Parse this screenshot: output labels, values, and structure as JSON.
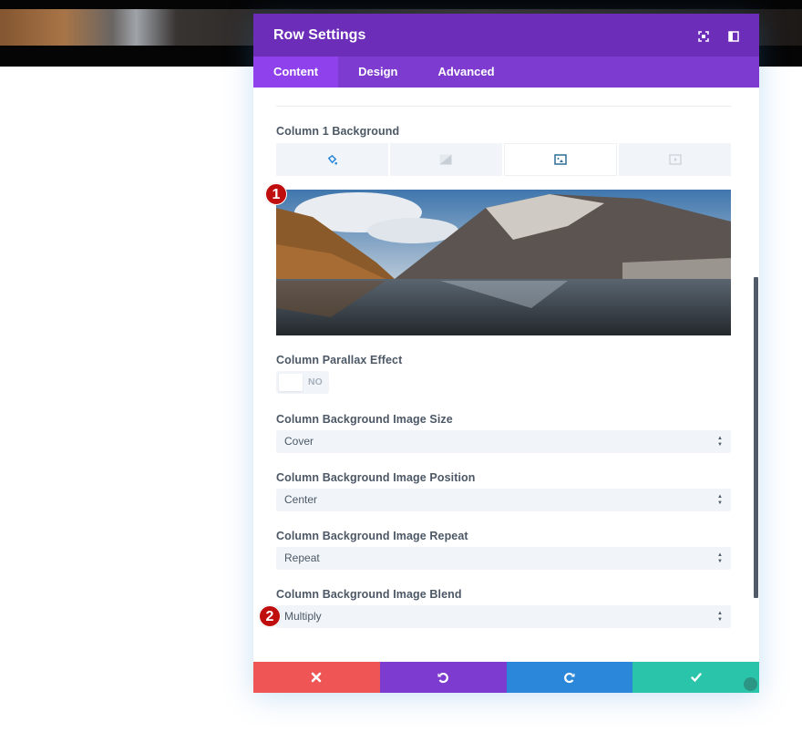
{
  "modal": {
    "title": "Row Settings",
    "header_icons": [
      "fullscreen-icon",
      "sidebar-layout-icon"
    ],
    "tabs": [
      {
        "label": "Content",
        "active": true
      },
      {
        "label": "Design",
        "active": false
      },
      {
        "label": "Advanced",
        "active": false
      }
    ]
  },
  "content": {
    "background_label": "Column 1 Background",
    "background_tabs": [
      {
        "icon": "paint-bucket-icon",
        "active": false
      },
      {
        "icon": "gradient-icon",
        "active": false
      },
      {
        "icon": "image-icon",
        "active": true
      },
      {
        "icon": "video-icon",
        "active": false
      }
    ],
    "parallax": {
      "label": "Column Parallax Effect",
      "value": "NO"
    },
    "image_size": {
      "label": "Column Background Image Size",
      "value": "Cover"
    },
    "image_position": {
      "label": "Column Background Image Position",
      "value": "Center"
    },
    "image_repeat": {
      "label": "Column Background Image Repeat",
      "value": "Repeat"
    },
    "image_blend": {
      "label": "Column Background Image Blend",
      "value": "Multiply"
    }
  },
  "annotations": [
    {
      "number": "1",
      "color": "#c00d0d"
    },
    {
      "number": "2",
      "color": "#c00d0d"
    }
  ],
  "footer": {
    "buttons": [
      {
        "action": "cancel",
        "icon": "close-icon",
        "color": "#ef5555"
      },
      {
        "action": "undo",
        "icon": "undo-icon",
        "color": "#7e3bd0"
      },
      {
        "action": "redo",
        "icon": "redo-icon",
        "color": "#2b87da"
      },
      {
        "action": "save",
        "icon": "check-icon",
        "color": "#29c4a9"
      }
    ]
  },
  "colors": {
    "header": "#6c2eb9",
    "tabs_bar": "#7e3bd0",
    "active_tab": "#8f42ec",
    "accent_blue": "#2b87da"
  }
}
